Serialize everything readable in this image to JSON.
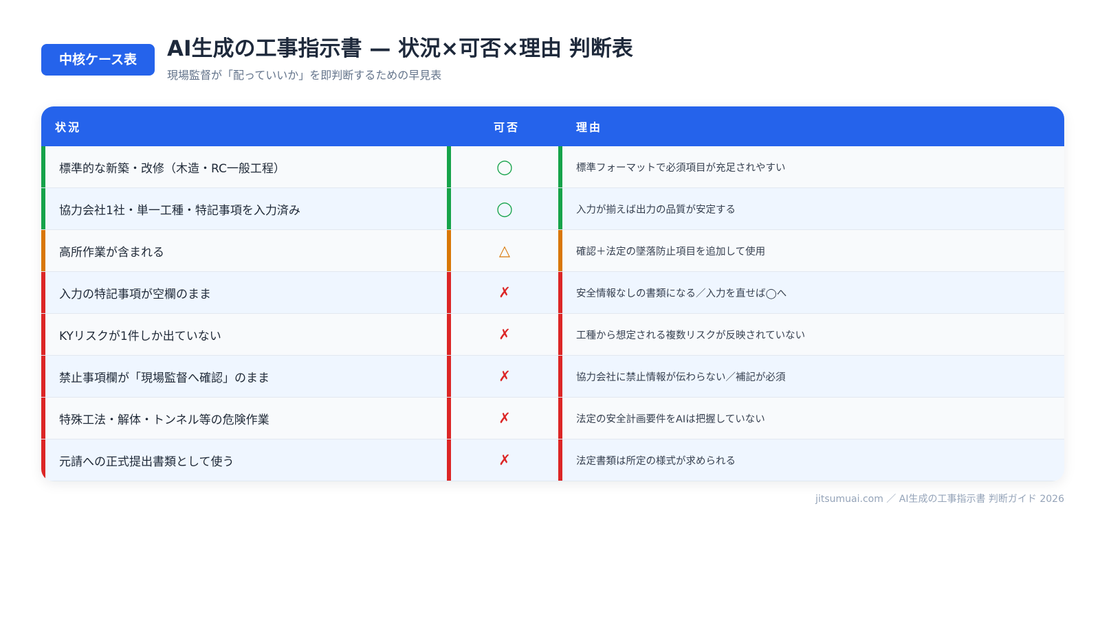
{
  "header": {
    "badge": "中核ケース表",
    "title": "AI生成の工事指示書 — 状況×可否×理由 判断表",
    "subtitle": "現場監督が「配っていいか」を即判断するための早見表"
  },
  "table": {
    "columns": [
      "状況",
      "可否",
      "理由"
    ],
    "status_colors": {
      "ok": "#16a34a",
      "caution": "#d97706",
      "ng": "#dc2626"
    },
    "rows": [
      {
        "situation": "標準的な新築・改修（木造・RC一般工程）",
        "verdict": "◯",
        "status": "ok",
        "reason": "標準フォーマットで必須項目が充足されやすい"
      },
      {
        "situation": "協力会社1社・単一工種・特記事項を入力済み",
        "verdict": "◯",
        "status": "ok",
        "reason": "入力が揃えば出力の品質が安定する"
      },
      {
        "situation": "高所作業が含まれる",
        "verdict": "△",
        "status": "caution",
        "reason": "確認＋法定の墜落防止項目を追加して使用"
      },
      {
        "situation": "入力の特記事項が空欄のまま",
        "verdict": "✗",
        "status": "ng",
        "reason": "安全情報なしの書類になる／入力を直せば◯へ"
      },
      {
        "situation": "KYリスクが1件しか出ていない",
        "verdict": "✗",
        "status": "ng",
        "reason": "工種から想定される複数リスクが反映されていない"
      },
      {
        "situation": "禁止事項欄が「現場監督へ確認」のまま",
        "verdict": "✗",
        "status": "ng",
        "reason": "協力会社に禁止情報が伝わらない／補記が必須"
      },
      {
        "situation": "特殊工法・解体・トンネル等の危険作業",
        "verdict": "✗",
        "status": "ng",
        "reason": "法定の安全計画要件をAIは把握していない"
      },
      {
        "situation": "元請への正式提出書類として使う",
        "verdict": "✗",
        "status": "ng",
        "reason": "法定書類は所定の様式が求められる"
      }
    ]
  },
  "footer": "jitsumuai.com ／ AI生成の工事指示書 判断ガイド 2026"
}
